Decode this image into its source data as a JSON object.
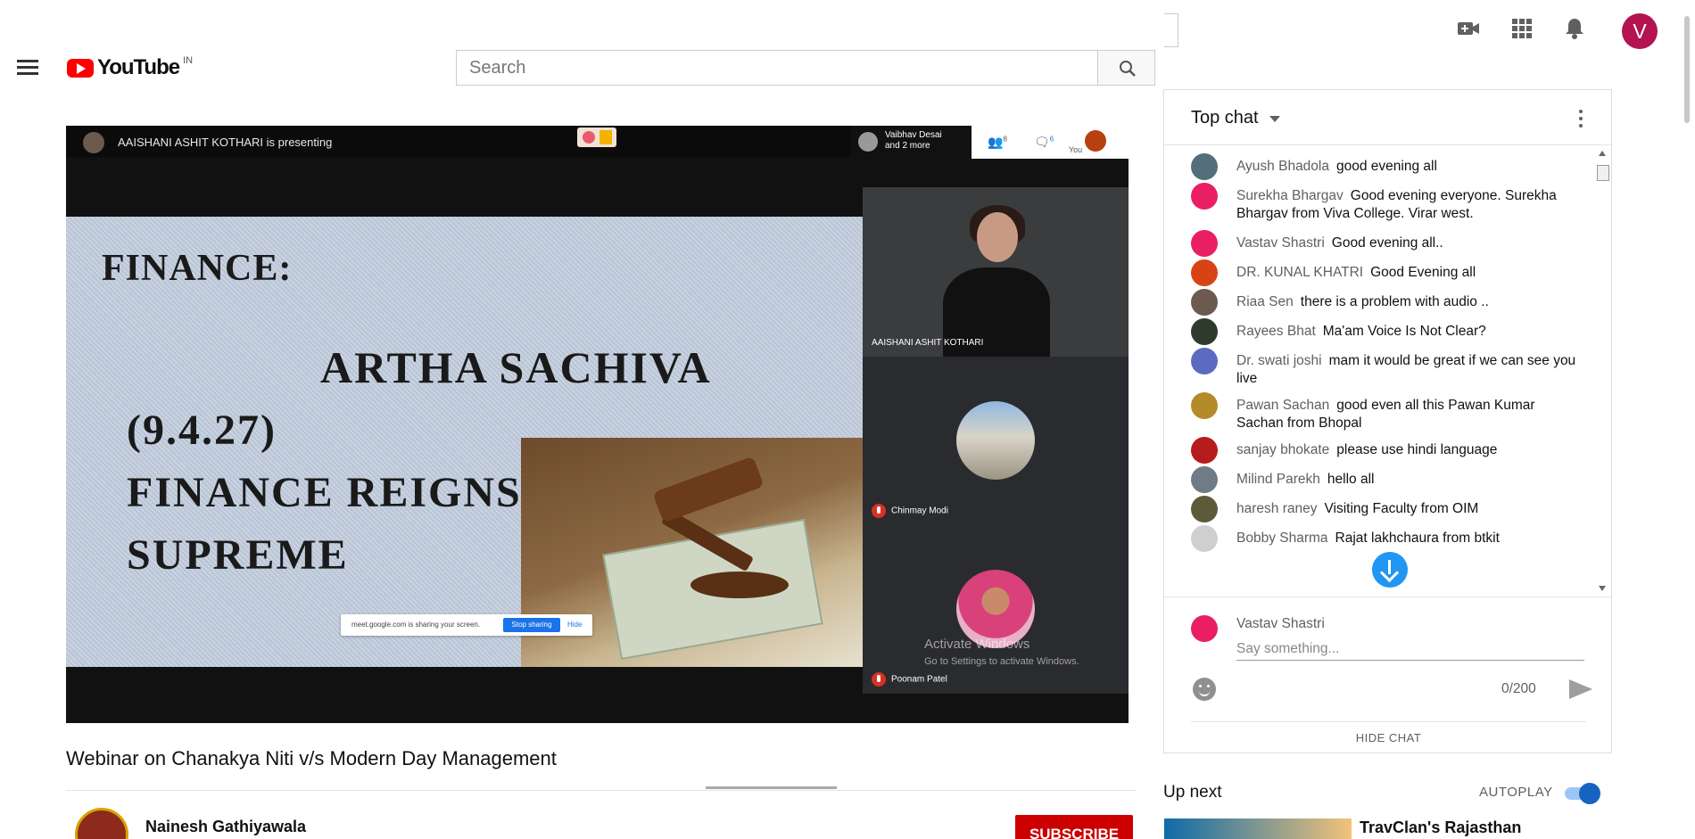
{
  "header": {
    "logo_text": "YouTube",
    "logo_country": "IN",
    "search_placeholder": "Search",
    "avatar_letter": "V"
  },
  "meeting": {
    "presenting_text": "AAISHANI ASHIT KOTHARI is presenting",
    "people_summary_line1": "Vaibhav Desai",
    "people_summary_line2": "and 2 more",
    "participants_count": "8",
    "chat_count": "6",
    "you_label": "You",
    "tiles": [
      {
        "name": "AAISHANI ASHIT KOTHARI"
      },
      {
        "name": "Chinmay Modi"
      },
      {
        "name": "Poonam Patel"
      }
    ],
    "share_bar": {
      "text": "meet.google.com is sharing your screen.",
      "stop": "Stop sharing",
      "hide": "Hide"
    },
    "activate_line1": "Activate Windows",
    "activate_line2": "Go to Settings to activate Windows."
  },
  "slide": {
    "line1": "FINANCE:",
    "line2": "ARTHA SACHIVA",
    "line3": "(9.4.27)\nFINANCE REIGNS\nSUPREME"
  },
  "video": {
    "title": "Webinar on Chanakya Niti v/s Modern Day Management",
    "channel": "Nainesh Gathiyawala",
    "subscribe_label": "SUBSCRIBE"
  },
  "chat": {
    "title": "Top chat",
    "messages": [
      {
        "author": "Ayush Bhadola",
        "text": "good evening all",
        "color": "#546e7a"
      },
      {
        "author": "Surekha Bhargav",
        "text": "Good evening everyone. Surekha Bhargav from Viva College. Virar west.",
        "color": "#e91e63"
      },
      {
        "author": "Vastav Shastri",
        "text": "Good evening all..",
        "color": "#e91e63"
      },
      {
        "author": "DR. KUNAL KHATRI",
        "text": "Good Evening all",
        "color": "#d84315"
      },
      {
        "author": "Riaa Sen",
        "text": "there is a problem with audio ..",
        "color": "#6d5a4e"
      },
      {
        "author": "Rayees Bhat",
        "text": "Ma'am Voice Is Not Clear?",
        "color": "#2e3b2c"
      },
      {
        "author": "Dr. swati joshi",
        "text": "mam it would be great if we can see you live",
        "color": "#5c6bc0"
      },
      {
        "author": "Pawan Sachan",
        "text": "good even all this Pawan Kumar Sachan from Bhopal",
        "color": "#b58b2a"
      },
      {
        "author": "sanjay bhokate",
        "text": "please use hindi language",
        "color": "#b71c1c"
      },
      {
        "author": "Milind Parekh",
        "text": "hello all",
        "color": "#6f7b86"
      },
      {
        "author": "haresh raney",
        "text": "Visiting Faculty from OIM",
        "color": "#5d5a3a"
      },
      {
        "author": "Bobby Sharma",
        "text": "Rajat lakhchaura from btkit",
        "color": "#cfcfcf"
      }
    ],
    "me_name": "Vastav Shastri",
    "input_placeholder": "Say something...",
    "counter": "0/200",
    "hide_label": "HIDE CHAT"
  },
  "upnext": {
    "label": "Up next",
    "autoplay_label": "AUTOPLAY",
    "next_title": "TravClan's Rajasthan"
  }
}
